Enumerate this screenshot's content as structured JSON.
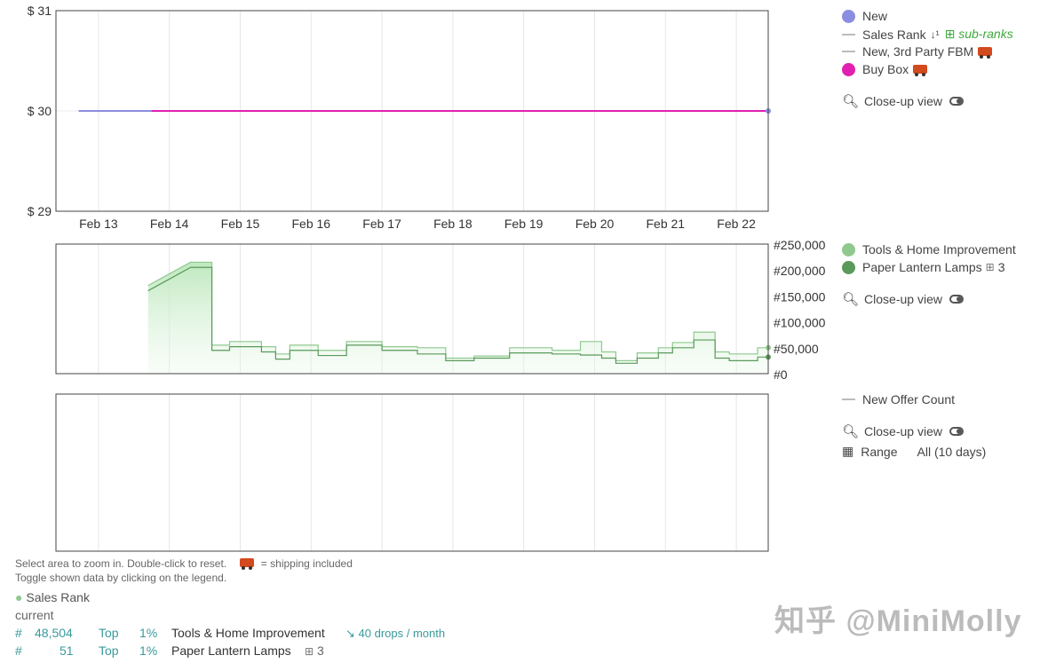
{
  "chart_data": [
    {
      "type": "line",
      "name": "price",
      "y_ticks": [
        "$ 31",
        "$ 30",
        "$ 29"
      ],
      "ylim": [
        29,
        31
      ],
      "x_ticks": [
        "Feb 13",
        "Feb 14",
        "Feb 15",
        "Feb 16",
        "Feb 17",
        "Feb 18",
        "Feb 19",
        "Feb 20",
        "Feb 21",
        "Feb 22"
      ],
      "xlim_days": [
        12.4,
        22.45
      ],
      "series": [
        {
          "name": "New",
          "color": "#8a8ee0",
          "points": [
            [
              12.72,
              30
            ],
            [
              22.45,
              30
            ]
          ]
        },
        {
          "name": "Buy Box",
          "color": "#e020b0",
          "points": [
            [
              13.75,
              30
            ],
            [
              22.45,
              30
            ]
          ]
        }
      ]
    },
    {
      "type": "area",
      "name": "sales-rank",
      "y_ticks": [
        "#250,000",
        "#200,000",
        "#150,000",
        "#100,000",
        "#50,000",
        "#0"
      ],
      "ylim": [
        0,
        250000
      ],
      "series": [
        {
          "name": "Tools & Home Improvement",
          "color": "#8fc98f",
          "points": [
            [
              13.7,
              170000
            ],
            [
              13.9,
              185000
            ],
            [
              14.1,
              200000
            ],
            [
              14.3,
              215000
            ],
            [
              14.6,
              215000
            ],
            [
              14.6,
              55000
            ],
            [
              14.85,
              55000
            ],
            [
              14.85,
              62000
            ],
            [
              15.3,
              62000
            ],
            [
              15.3,
              52000
            ],
            [
              15.5,
              52000
            ],
            [
              15.5,
              38000
            ],
            [
              15.7,
              38000
            ],
            [
              15.7,
              55000
            ],
            [
              16.1,
              55000
            ],
            [
              16.1,
              45000
            ],
            [
              16.5,
              45000
            ],
            [
              16.5,
              62000
            ],
            [
              17.0,
              62000
            ],
            [
              17.0,
              52000
            ],
            [
              17.5,
              52000
            ],
            [
              17.5,
              50000
            ],
            [
              17.9,
              50000
            ],
            [
              17.9,
              30000
            ],
            [
              18.3,
              30000
            ],
            [
              18.3,
              34000
            ],
            [
              18.8,
              34000
            ],
            [
              18.8,
              50000
            ],
            [
              19.4,
              50000
            ],
            [
              19.4,
              45000
            ],
            [
              19.8,
              45000
            ],
            [
              19.8,
              62000
            ],
            [
              20.1,
              62000
            ],
            [
              20.1,
              42000
            ],
            [
              20.3,
              42000
            ],
            [
              20.3,
              25000
            ],
            [
              20.6,
              25000
            ],
            [
              20.6,
              40000
            ],
            [
              20.9,
              40000
            ],
            [
              20.9,
              50000
            ],
            [
              21.1,
              50000
            ],
            [
              21.1,
              60000
            ],
            [
              21.4,
              60000
            ],
            [
              21.4,
              80000
            ],
            [
              21.7,
              80000
            ],
            [
              21.7,
              42000
            ],
            [
              21.9,
              42000
            ],
            [
              21.9,
              38000
            ],
            [
              22.3,
              38000
            ],
            [
              22.3,
              50000
            ],
            [
              22.45,
              50000
            ]
          ]
        },
        {
          "name": "Paper Lantern Lamps",
          "color": "#5a9a5a",
          "points": [
            [
              13.7,
              160000
            ],
            [
              13.9,
              175000
            ],
            [
              14.1,
              190000
            ],
            [
              14.3,
              205000
            ],
            [
              14.6,
              205000
            ],
            [
              14.6,
              45000
            ],
            [
              14.85,
              45000
            ],
            [
              14.85,
              52000
            ],
            [
              15.3,
              52000
            ],
            [
              15.3,
              42000
            ],
            [
              15.5,
              42000
            ],
            [
              15.5,
              28000
            ],
            [
              15.7,
              28000
            ],
            [
              15.7,
              45000
            ],
            [
              16.1,
              45000
            ],
            [
              16.1,
              35000
            ],
            [
              16.5,
              35000
            ],
            [
              16.5,
              55000
            ],
            [
              17.0,
              55000
            ],
            [
              17.0,
              45000
            ],
            [
              17.5,
              45000
            ],
            [
              17.5,
              38000
            ],
            [
              17.9,
              38000
            ],
            [
              17.9,
              25000
            ],
            [
              18.3,
              25000
            ],
            [
              18.3,
              30000
            ],
            [
              18.8,
              30000
            ],
            [
              18.8,
              40000
            ],
            [
              19.4,
              40000
            ],
            [
              19.4,
              38000
            ],
            [
              19.8,
              38000
            ],
            [
              19.8,
              36000
            ],
            [
              20.1,
              36000
            ],
            [
              20.1,
              30000
            ],
            [
              20.3,
              30000
            ],
            [
              20.3,
              20000
            ],
            [
              20.6,
              20000
            ],
            [
              20.6,
              30000
            ],
            [
              20.9,
              30000
            ],
            [
              20.9,
              40000
            ],
            [
              21.1,
              40000
            ],
            [
              21.1,
              50000
            ],
            [
              21.4,
              50000
            ],
            [
              21.4,
              65000
            ],
            [
              21.7,
              65000
            ],
            [
              21.7,
              30000
            ],
            [
              21.9,
              30000
            ],
            [
              21.9,
              25000
            ],
            [
              22.3,
              25000
            ],
            [
              22.3,
              32000
            ],
            [
              22.45,
              32000
            ]
          ]
        }
      ]
    },
    {
      "type": "line",
      "name": "offer-count",
      "series": []
    }
  ],
  "legend_price": {
    "new": "New",
    "sales_rank": "Sales Rank",
    "sub_ranks": "sub-ranks",
    "third_party": "New, 3rd Party FBM",
    "buy_box": "Buy Box",
    "closeup": "Close-up view"
  },
  "legend_rank": {
    "tools": "Tools & Home Improvement",
    "lantern": "Paper Lantern Lamps",
    "lantern_count": "3",
    "closeup": "Close-up view"
  },
  "legend_offers": {
    "offer_count": "New Offer Count",
    "closeup": "Close-up view",
    "range_label": "Range",
    "range_value": "All (10 days)"
  },
  "footer": {
    "zoom_hint": "Select area to zoom in. Double-click to reset.",
    "shipping_note": "= shipping included",
    "toggle_hint": "Toggle shown data by clicking on the legend."
  },
  "sales_rank_table": {
    "title": "Sales Rank",
    "current_label": "current",
    "rows": [
      {
        "hash": "#",
        "value": "48,504",
        "top": "Top",
        "pct": "1%",
        "category": "Tools & Home Improvement",
        "drops": "40 drops / month"
      },
      {
        "hash": "#",
        "value": "51",
        "top": "Top",
        "pct": "1%",
        "category": "Paper Lantern Lamps",
        "sub_count": "3"
      }
    ]
  },
  "watermark": "知乎 @MiniMolly",
  "colors": {
    "new": "#8a8ee0",
    "buy_box": "#e020b0",
    "tools": "#8fc98f",
    "lantern": "#5a9a5a",
    "teal": "#3a9a9a"
  }
}
